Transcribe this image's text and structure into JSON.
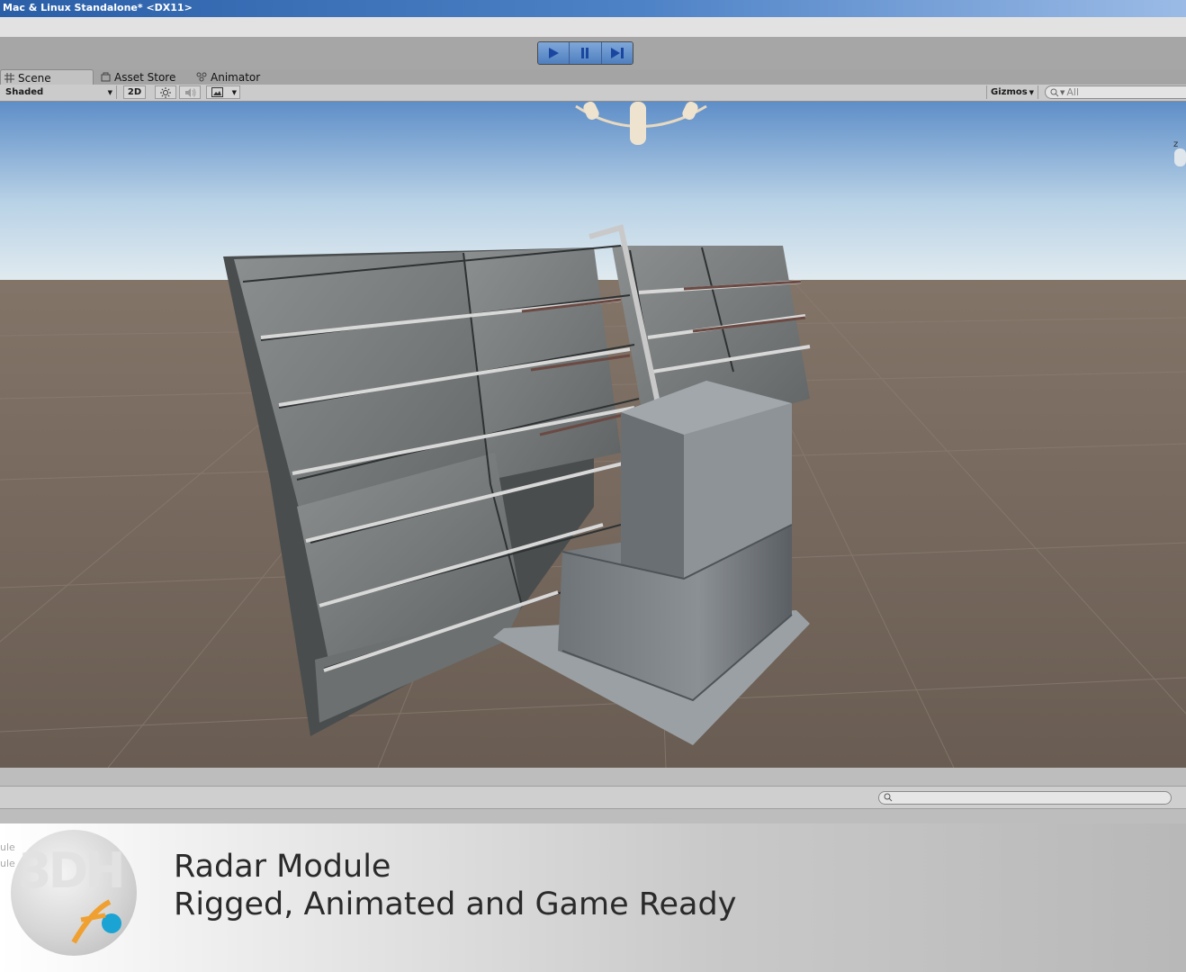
{
  "window": {
    "title": "Mac & Linux Standalone* <DX11>"
  },
  "playmode": {
    "play_icon": "play-icon",
    "pause_icon": "pause-icon",
    "step_icon": "step-icon"
  },
  "tabs": [
    {
      "label": "Scene",
      "icon": "grid-icon",
      "active": true
    },
    {
      "label": "Asset Store",
      "icon": "store-icon",
      "active": false
    },
    {
      "label": "Animator",
      "icon": "animator-icon",
      "active": false
    }
  ],
  "scene_toolbar": {
    "draw_mode": "Shaded",
    "mode_2d": "2D",
    "lighting_icon": "sun-icon",
    "audio_icon": "speaker-icon",
    "effects_icon": "image-icon",
    "gizmos_label": "Gizmos",
    "search_placeholder": "All"
  },
  "gizmo": {
    "axis_label": "z"
  },
  "caption": {
    "title": "Radar Module",
    "subtitle": "Rigged, Animated and Game Ready",
    "faded_left_1": "ule",
    "faded_left_2": "ule",
    "logo_text": "3DH"
  },
  "colors": {
    "sky_top": "#5b8cc6",
    "ground": "#6a5e55",
    "accent_blue": "#4f7fbf"
  }
}
